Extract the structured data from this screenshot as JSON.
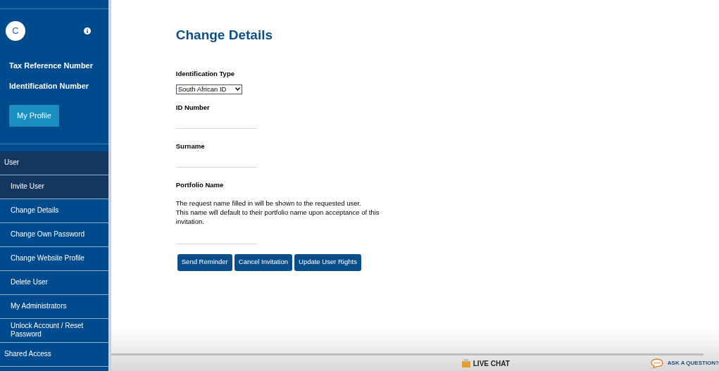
{
  "profile": {
    "avatar_initial": "C",
    "fields": [
      "Tax Reference Number",
      "Identification Number"
    ],
    "button": "My Profile"
  },
  "menu": [
    {
      "kind": "section",
      "label": "User",
      "expanded": true
    },
    {
      "kind": "item",
      "label": "Invite User",
      "selected": true
    },
    {
      "kind": "item",
      "label": "Change Details",
      "selected": false
    },
    {
      "kind": "item",
      "label": "Change Own Password",
      "selected": false
    },
    {
      "kind": "item",
      "label": "Change Website Profile",
      "selected": false
    },
    {
      "kind": "item",
      "label": "Delete User",
      "selected": false
    },
    {
      "kind": "item",
      "label": "My Administrators",
      "selected": false
    },
    {
      "kind": "item",
      "label": "Unlock Account / Reset Password",
      "selected": false
    },
    {
      "kind": "section",
      "label": "Shared Access",
      "expanded": false
    }
  ],
  "page": {
    "title": "Change Details",
    "identification_type": {
      "label": "Identification Type",
      "value": "South African ID"
    },
    "id_number": {
      "label": "ID Number"
    },
    "surname": {
      "label": "Surname"
    },
    "portfolio_name": {
      "label": "Portfolio Name",
      "note": "The request name filled in will be shown to the requested user.\nThis name will default to their portfolio name upon acceptance of this invitation."
    },
    "buttons": [
      "Send Reminder",
      "Cancel Invitation",
      "Update User Rights"
    ]
  },
  "footer": {
    "live_chat": "LIVE CHAT",
    "ask": "ASK A QUESTION?"
  }
}
